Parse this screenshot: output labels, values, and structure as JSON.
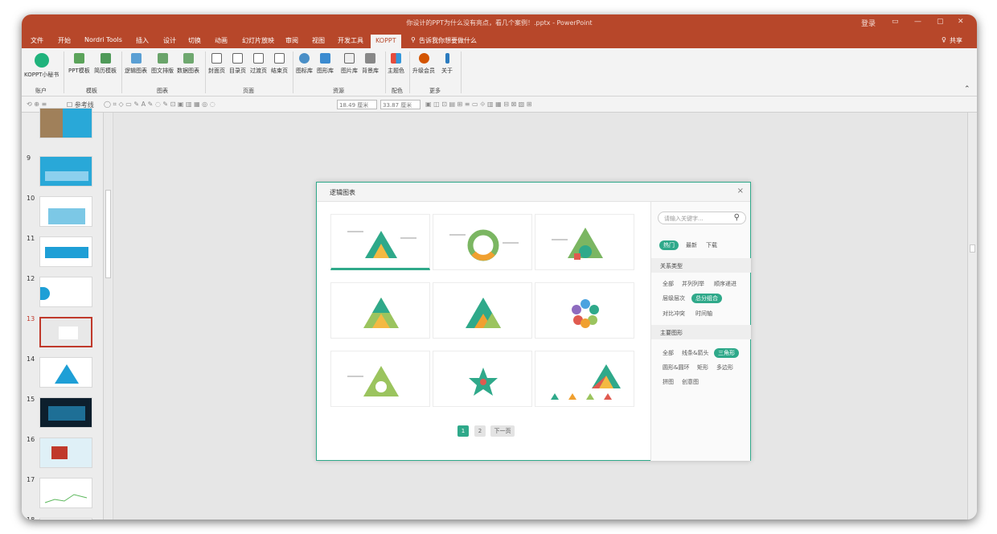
{
  "window": {
    "title": "你设计的PPT为什么没有亮点，看几个案例！.pptx  -  PowerPoint",
    "login": "登录",
    "share": "共享"
  },
  "menu_tabs": [
    "文件",
    "开始",
    "Nordri Tools",
    "插入",
    "设计",
    "切换",
    "动画",
    "幻灯片放映",
    "审阅",
    "视图",
    "开发工具",
    "KOPPT"
  ],
  "tell_me": "告诉我你想要做什么",
  "ribbon": {
    "buttons": [
      "KOPPT小秘书",
      "PPT模板",
      "简历模板",
      "逻辑图表",
      "图文排版",
      "数据图表",
      "封面页",
      "目录页",
      "过渡页",
      "结束页",
      "图标库",
      "图形库",
      "图片库",
      "背景库",
      "主题色",
      "升级会员",
      "关于"
    ],
    "groups": [
      "账户",
      "模板",
      "图表",
      "页面",
      "资源",
      "配色",
      "更多"
    ]
  },
  "toolbar": {
    "guides": "参考线",
    "width": "18.49 厘米",
    "height": "33.87 厘米"
  },
  "slides": [
    "9",
    "10",
    "11",
    "12",
    "13",
    "14",
    "15",
    "16",
    "17",
    "18"
  ],
  "selected_slide": "13",
  "dialog": {
    "title": "逻辑图表",
    "close": "×",
    "search_placeholder": "请输入关键字...",
    "sort_tabs": [
      "热门",
      "最新",
      "下载"
    ],
    "relation_title": "关系类型",
    "relation_tags": [
      "全部",
      "并列列举",
      "顺序递进",
      "层级层次",
      "总分组合",
      "对比冲突",
      "时间轴"
    ],
    "shape_title": "主要图形",
    "shape_tags": [
      "全部",
      "线条&箭头",
      "三角形",
      "圆形&圆环",
      "矩形",
      "多边形",
      "拼图",
      "创意图"
    ],
    "pages": [
      "1",
      "2",
      "下一页"
    ]
  },
  "colors": {
    "accent": "#2fa98a",
    "brand": "#b7472a"
  }
}
